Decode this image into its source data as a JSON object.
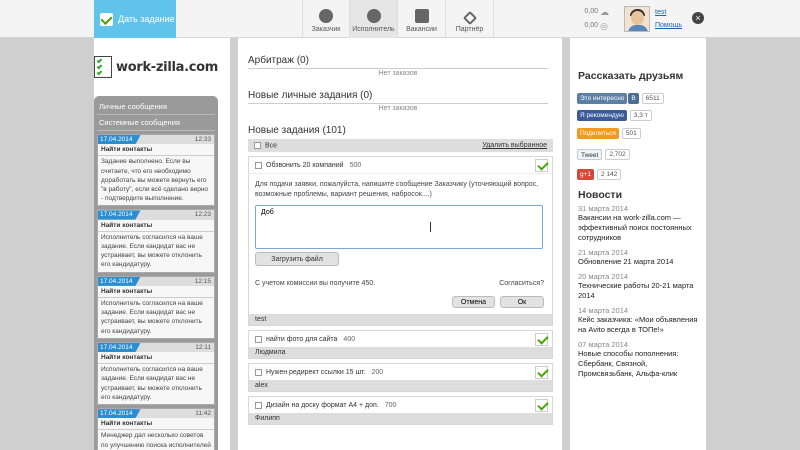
{
  "topbar": {
    "give_task_label": "Дать задание",
    "nav": [
      {
        "label": "Заказчик"
      },
      {
        "label": "Исполнитель"
      },
      {
        "label": "Вакансии"
      },
      {
        "label": "Партнёр"
      }
    ],
    "balance_top": "0,00",
    "balance_bottom": "0,00",
    "user_name": "test",
    "help_label": "Помощь"
  },
  "logo": {
    "text": "work-zilla.com"
  },
  "messages": {
    "personal_header": "Личные сообщения",
    "system_header": "Системные сообщения",
    "items": [
      {
        "date": "17.04.2014",
        "time": "12:33",
        "title": "Найти контакты",
        "body": "Задание выполнено. Если вы считаете, что его необходимо доработать вы можете вернуть его \"в работу\", если всё сделано верно - подтвердите выполнение."
      },
      {
        "date": "17.04.2014",
        "time": "12:23",
        "title": "Найти контакты",
        "body": "Исполнитель согласился на ваше задание. Если кандидат вас не устраивает, вы можете отклонить его кандидатуру."
      },
      {
        "date": "17.04.2014",
        "time": "12:15",
        "title": "Найти контакты",
        "body": "Исполнитель согласился на ваше задание. Если кандидат вас не устраивает, вы можете отклонить его кандидатуру."
      },
      {
        "date": "17.04.2014",
        "time": "12:11",
        "title": "Найти контакты",
        "body": "Исполнитель согласился на ваше задание. Если кандидат вас не устраивает, вы можете отклонить его кандидатуру."
      },
      {
        "date": "17.04.2014",
        "time": "11:42",
        "title": "Найти контакты",
        "body": "Менеджер дал несколько советов по улучшению поиска исполнителей"
      }
    ]
  },
  "main": {
    "arbitrage_title": "Арбитраж (0)",
    "arbitrage_empty": "Нет заказов",
    "personal_tasks_title": "Новые личные задания (0)",
    "personal_tasks_empty": "Нет заказов",
    "new_tasks_title": "Новые задания (101)",
    "all_label": "Все",
    "delete_selected": "Удалить выбранное",
    "expanded_task": {
      "title": "Обзвонить 20 компаний",
      "amount": "500",
      "hint": "Для подачи заявки, пожалуйста, напишите сообщение Заказчику (уточняющий вопрос, возможные проблемы, вариант решения, набросок....)",
      "reply_value": "Доб",
      "upload_label": "Загрузить файл",
      "commission_text": "С учетом комиссии вы получите 450.",
      "agree_label": "Согласиться?",
      "cancel_label": "Отмена",
      "ok_label": "Ок",
      "author": "test"
    },
    "tasks": [
      {
        "title": "найти фото для сайта",
        "amount": "400",
        "author": "Людмила"
      },
      {
        "title": "Нужен редирект ссылки 15 шт.",
        "amount": "200",
        "author": "alex"
      },
      {
        "title": "Дизайн на доску формат А4 + доп.",
        "amount": "700",
        "author": "Филипп"
      }
    ]
  },
  "share": {
    "title": "Рассказать друзьям",
    "vk_label": "Это интересно",
    "vk_icon": "В",
    "vk_count": "6511",
    "fb_label": "Я рекомендую",
    "fb_count": "3,3 т",
    "ok_label": "Поделиться",
    "ok_count": "501",
    "tw_label": "Tweet",
    "tw_count": "2,702",
    "gp_label": "g+1",
    "gp_count": "2 142"
  },
  "news": {
    "title": "Новости",
    "items": [
      {
        "date": "31 марта 2014",
        "text": "Вакансии на work-zilla.com — эффективный поиск постоянных сотрудников"
      },
      {
        "date": "21 марта 2014",
        "text": "Обновление 21 марта 2014"
      },
      {
        "date": "20 марта 2014",
        "text": "Технические работы 20-21 марта 2014"
      },
      {
        "date": "14 марта 2014",
        "text": "Кейс заказчика: «Мои объявления на Avito всегда в ТОПе!»"
      },
      {
        "date": "07 марта 2014",
        "text": "Новые способы пополнения: Сбербанк, Связной, Промсвязьбанк, Альфа-клик"
      }
    ]
  },
  "colors": {
    "accent": "#5fc3ec",
    "check_green": "#46a800",
    "date_badge": "#2a8ed0"
  }
}
